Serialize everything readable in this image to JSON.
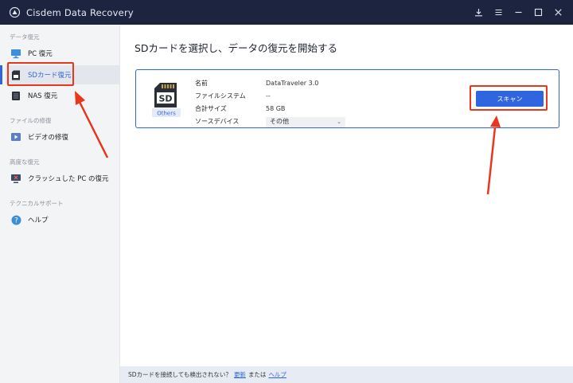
{
  "window": {
    "title": "Cisdem Data Recovery",
    "controls": [
      "download-icon",
      "menu-icon",
      "minimize-icon",
      "maximize-icon",
      "close-icon"
    ]
  },
  "sidebar": {
    "sections": [
      {
        "label": "データ復元",
        "items": [
          {
            "label": "PC 復元",
            "icon": "monitor-icon"
          },
          {
            "label": "SDカード復元",
            "icon": "sd-card-icon",
            "active": true
          },
          {
            "label": "NAS 復元",
            "icon": "nas-icon"
          }
        ]
      },
      {
        "label": "ファイルの修復",
        "items": [
          {
            "label": "ビデオの修復",
            "icon": "video-repair-icon"
          }
        ]
      },
      {
        "label": "高度な復元",
        "items": [
          {
            "label": "クラッシュした PC の復元",
            "icon": "crashed-pc-icon"
          }
        ]
      },
      {
        "label": "テクニカルサポート",
        "items": [
          {
            "label": "ヘルプ",
            "icon": "help-icon"
          }
        ]
      }
    ]
  },
  "main": {
    "title": "SDカードを選択し、データの復元を開始する",
    "device": {
      "icon_text": "SD",
      "icon_caption": "Others",
      "labels": {
        "name": "名前",
        "filesystem": "ファイルシステム",
        "total_size": "合計サイズ",
        "source_device": "ソースデバイス"
      },
      "values": {
        "name": "DataTraveler 3.0",
        "filesystem": "--",
        "total_size": "58 GB",
        "source_device": "その他"
      }
    },
    "scan_button": "スキャン"
  },
  "footer": {
    "text": "SDカードを接続しても検出されない？",
    "refresh_link": "更新",
    "or": "または",
    "help_link": "ヘルプ"
  },
  "colors": {
    "titlebar": "#1c2440",
    "accent": "#2f66e0",
    "annotation": "#e8371c",
    "sidebar_bg": "#f3f4f6",
    "footer_bg": "#e7ebf4"
  }
}
